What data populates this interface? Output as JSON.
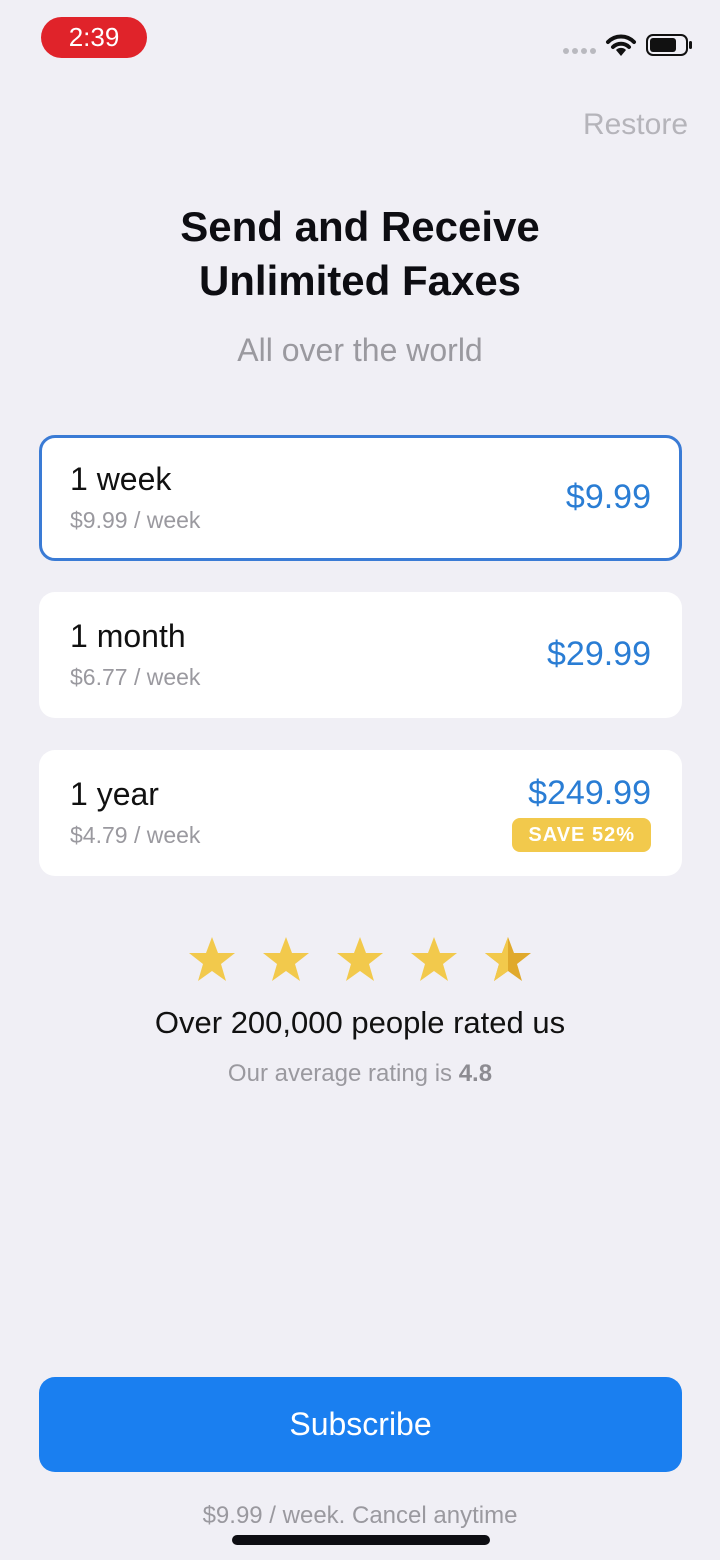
{
  "status_bar": {
    "time": "2:39",
    "icons": [
      "cellular-signal-icon",
      "wifi-icon",
      "battery-icon"
    ]
  },
  "header": {
    "restore_label": "Restore",
    "title_line1": "Send and Receive",
    "title_line2": "Unlimited Faxes",
    "subtitle": "All over the world"
  },
  "plans": [
    {
      "name": "1 week",
      "per_week": "$9.99 / week",
      "price": "$9.99",
      "selected": true
    },
    {
      "name": "1 month",
      "per_week": "$6.77 / week",
      "price": "$29.99",
      "selected": false
    },
    {
      "name": "1 year",
      "per_week": "$4.79 / week",
      "price": "$249.99",
      "badge": "SAVE 52%",
      "selected": false
    }
  ],
  "rating": {
    "stars": 4.5,
    "headline": "Over 200,000 people rated us",
    "average_prefix": "Our average rating is",
    "average_value": "4.8"
  },
  "cta": {
    "subscribe_label": "Subscribe",
    "footer_note": "$9.99 / week. Cancel anytime"
  },
  "colors": {
    "background": "#f0eff5",
    "accent": "#1a7ff0",
    "price": "#2a7dd4",
    "badge": "#f2c94c",
    "star": "#f2c94c",
    "recording_pill": "#e0232a"
  }
}
